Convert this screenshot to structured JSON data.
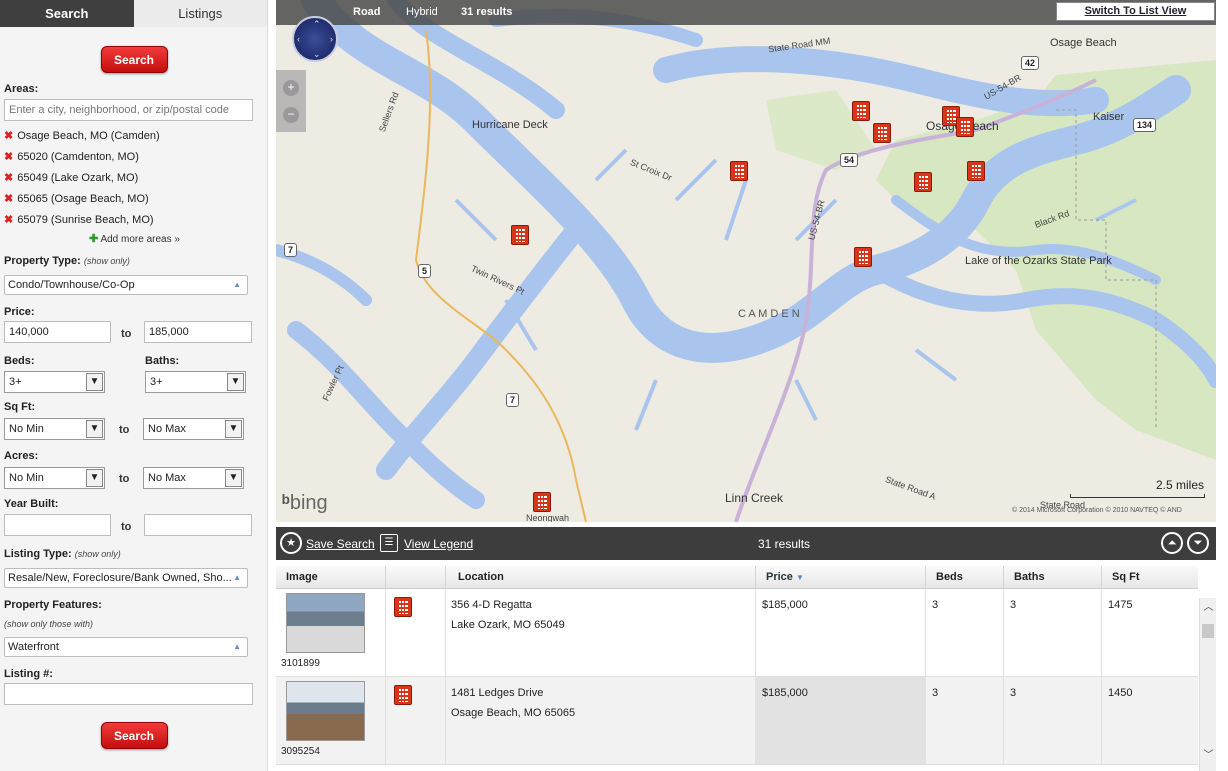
{
  "sidebar": {
    "tabs": {
      "search": "Search",
      "listings": "Listings"
    },
    "search_button": "Search",
    "areas": {
      "label": "Areas:",
      "placeholder": "Enter a city, neighborhood, or zip/postal code",
      "items": [
        "Osage Beach, MO (Camden)",
        "65020 (Camdenton, MO)",
        "65049 (Lake Ozark, MO)",
        "65065 (Osage Beach, MO)",
        "65079 (Sunrise Beach, MO)"
      ],
      "add_more": "Add more areas »"
    },
    "property_type": {
      "label": "Property Type:",
      "sub": "(show only)",
      "value": "Condo/Townhouse/Co-Op"
    },
    "price": {
      "label": "Price:",
      "min": "140,000",
      "to": "to",
      "max": "185,000"
    },
    "beds": {
      "label": "Beds:",
      "value": "3+"
    },
    "baths": {
      "label": "Baths:",
      "value": "3+"
    },
    "sqft": {
      "label": "Sq Ft:",
      "min": "No Min",
      "to": "to",
      "max": "No Max"
    },
    "acres": {
      "label": "Acres:",
      "min": "No Min",
      "to": "to",
      "max": "No Max"
    },
    "year_built": {
      "label": "Year Built:",
      "to": "to"
    },
    "listing_type": {
      "label": "Listing Type:",
      "sub": "(show only)",
      "value": "Resale/New, Foreclosure/Bank Owned, Sho..."
    },
    "property_features": {
      "label": "Property Features:",
      "sub": "(show only those with)",
      "value": "Waterfront"
    },
    "listing_num": {
      "label": "Listing #:"
    }
  },
  "map": {
    "modes": [
      "Road",
      "Hybrid"
    ],
    "results": "31 results",
    "switch_label": "Switch To List View",
    "brand": "bing",
    "scale": "2.5 miles",
    "copyright": "© 2014 Microsoft Corporation   © 2010 NAVTEQ   © AND",
    "labels": {
      "osage_beach_top": "Osage Beach",
      "osage_beach": "Osage Beach",
      "hurricane_deck": "Hurricane Deck",
      "kaiser": "Kaiser",
      "lake_state_park": "Lake of the Ozarks State Park",
      "camden": "C A M D E N",
      "linn_creek": "Linn Creek",
      "state_road_mm": "State Road MM",
      "sellers_rd": "Sellers Rd",
      "st_croix": "St Croix Dr",
      "twin_rivers": "Twin Rivers Pt",
      "black_rd": "Black Rd",
      "state_road_a": "State Road A",
      "state_road": "State Road",
      "fowler": "Fowler Pt",
      "us54br_top": "US-54-BR",
      "us54br": "US-54-BR",
      "neongwah": "Neongwah"
    },
    "shields": {
      "r42": "42",
      "r134": "134",
      "r54": "54",
      "r7a": "7",
      "r5": "5",
      "r7b": "7"
    }
  },
  "results_bar": {
    "save_search": "Save Search",
    "view_legend": "View Legend",
    "count": "31 results"
  },
  "table": {
    "headers": [
      "Image",
      "",
      "Location",
      "Price",
      "Beds",
      "Baths",
      "Sq Ft"
    ],
    "rows": [
      {
        "id": "3101899",
        "address": "356 4-D Regatta",
        "city": "Lake Ozark, MO  65049",
        "price": "$185,000",
        "beds": "3",
        "baths": "3",
        "sqft": "1475"
      },
      {
        "id": "3095254",
        "address": "1481 Ledges Drive",
        "city": "Osage Beach, MO  65065",
        "price": "$185,000",
        "beds": "3",
        "baths": "3",
        "sqft": "1450"
      }
    ]
  }
}
